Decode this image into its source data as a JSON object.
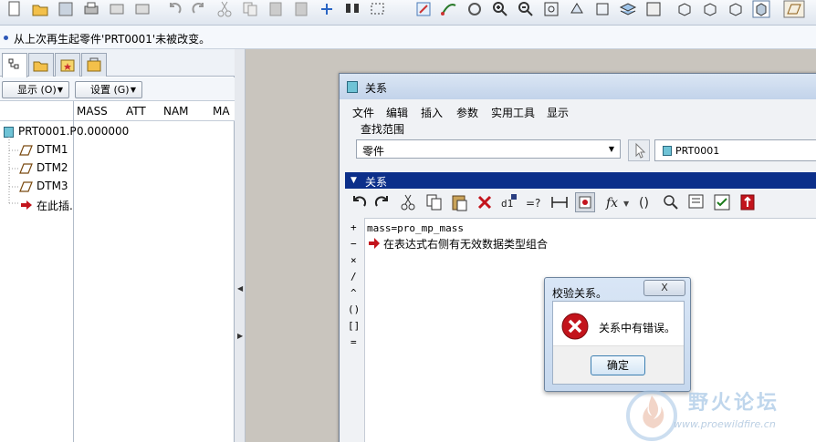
{
  "message_bar": {
    "text": "从上次再生起零件'PRT0001'未被改变。"
  },
  "model_tree": {
    "show_button": "显示 (O)",
    "settings_button": "设置 (G)",
    "columns": [
      "MASS",
      "ATT",
      "NAM",
      "MA"
    ],
    "items": [
      {
        "label": "PRT0001.P",
        "value": "0.000000",
        "icon": "part-icon"
      },
      {
        "label": "DTM1",
        "icon": "datum-plane-icon"
      },
      {
        "label": "DTM2",
        "icon": "datum-plane-icon"
      },
      {
        "label": "DTM3",
        "icon": "datum-plane-icon"
      },
      {
        "label": "在此插.",
        "icon": "insert-here-arrow-icon"
      }
    ]
  },
  "relations_window": {
    "title": "关系",
    "menu": [
      "文件",
      "编辑",
      "插入",
      "参数",
      "实用工具",
      "显示"
    ],
    "search_scope_label": "查找范围",
    "scope_select": "零件",
    "model_name": "PRT0001",
    "section_label": "关系",
    "operators": [
      "+",
      "−",
      "×",
      "/",
      "^",
      "()",
      "[]",
      "="
    ],
    "code_line": "mass=pro_mp_mass",
    "error_line": "在表达式右侧有无效数据类型组合"
  },
  "dialog": {
    "title": "校验关系。",
    "close_label": "X",
    "message": "关系中有错误。",
    "ok_label": "确定",
    "icon": "error-icon"
  },
  "watermark": {
    "text": "野火论坛",
    "url": "www.proewildfire.cn"
  },
  "colors": {
    "section_bar": "#0c2f8a",
    "workspace": "#c9c5be",
    "error_red": "#c3141c"
  }
}
